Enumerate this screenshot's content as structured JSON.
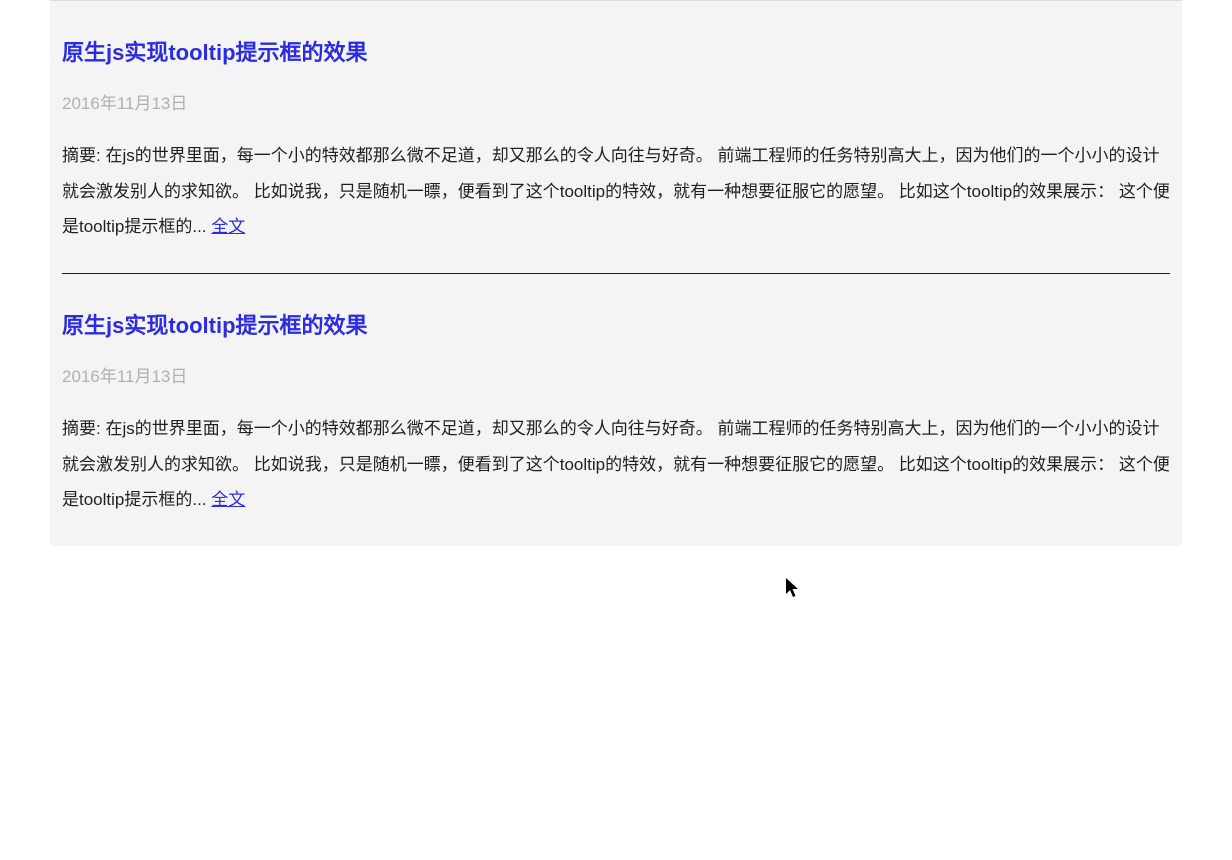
{
  "articles": [
    {
      "title": "原生js实现tooltip提示框的效果",
      "date": "2016年11月13日",
      "summary": "摘要: 在js的世界里面，每一个小的特效都那么微不足道，却又那么的令人向往与好奇。 前端工程师的任务特别高大上，因为他们的一个小小的设计就会激发别人的求知欲。 比如说我，只是随机一瞟，便看到了这个tooltip的特效，就有一种想要征服它的愿望。 比如这个tooltip的效果展示： 这个便是tooltip提示框的... ",
      "full_link": "全文"
    },
    {
      "title": "原生js实现tooltip提示框的效果",
      "date": "2016年11月13日",
      "summary": "摘要: 在js的世界里面，每一个小的特效都那么微不足道，却又那么的令人向往与好奇。 前端工程师的任务特别高大上，因为他们的一个小小的设计就会激发别人的求知欲。 比如说我，只是随机一瞟，便看到了这个tooltip的特效，就有一种想要征服它的愿望。 比如这个tooltip的效果展示： 这个便是tooltip提示框的... ",
      "full_link": "全文"
    }
  ]
}
